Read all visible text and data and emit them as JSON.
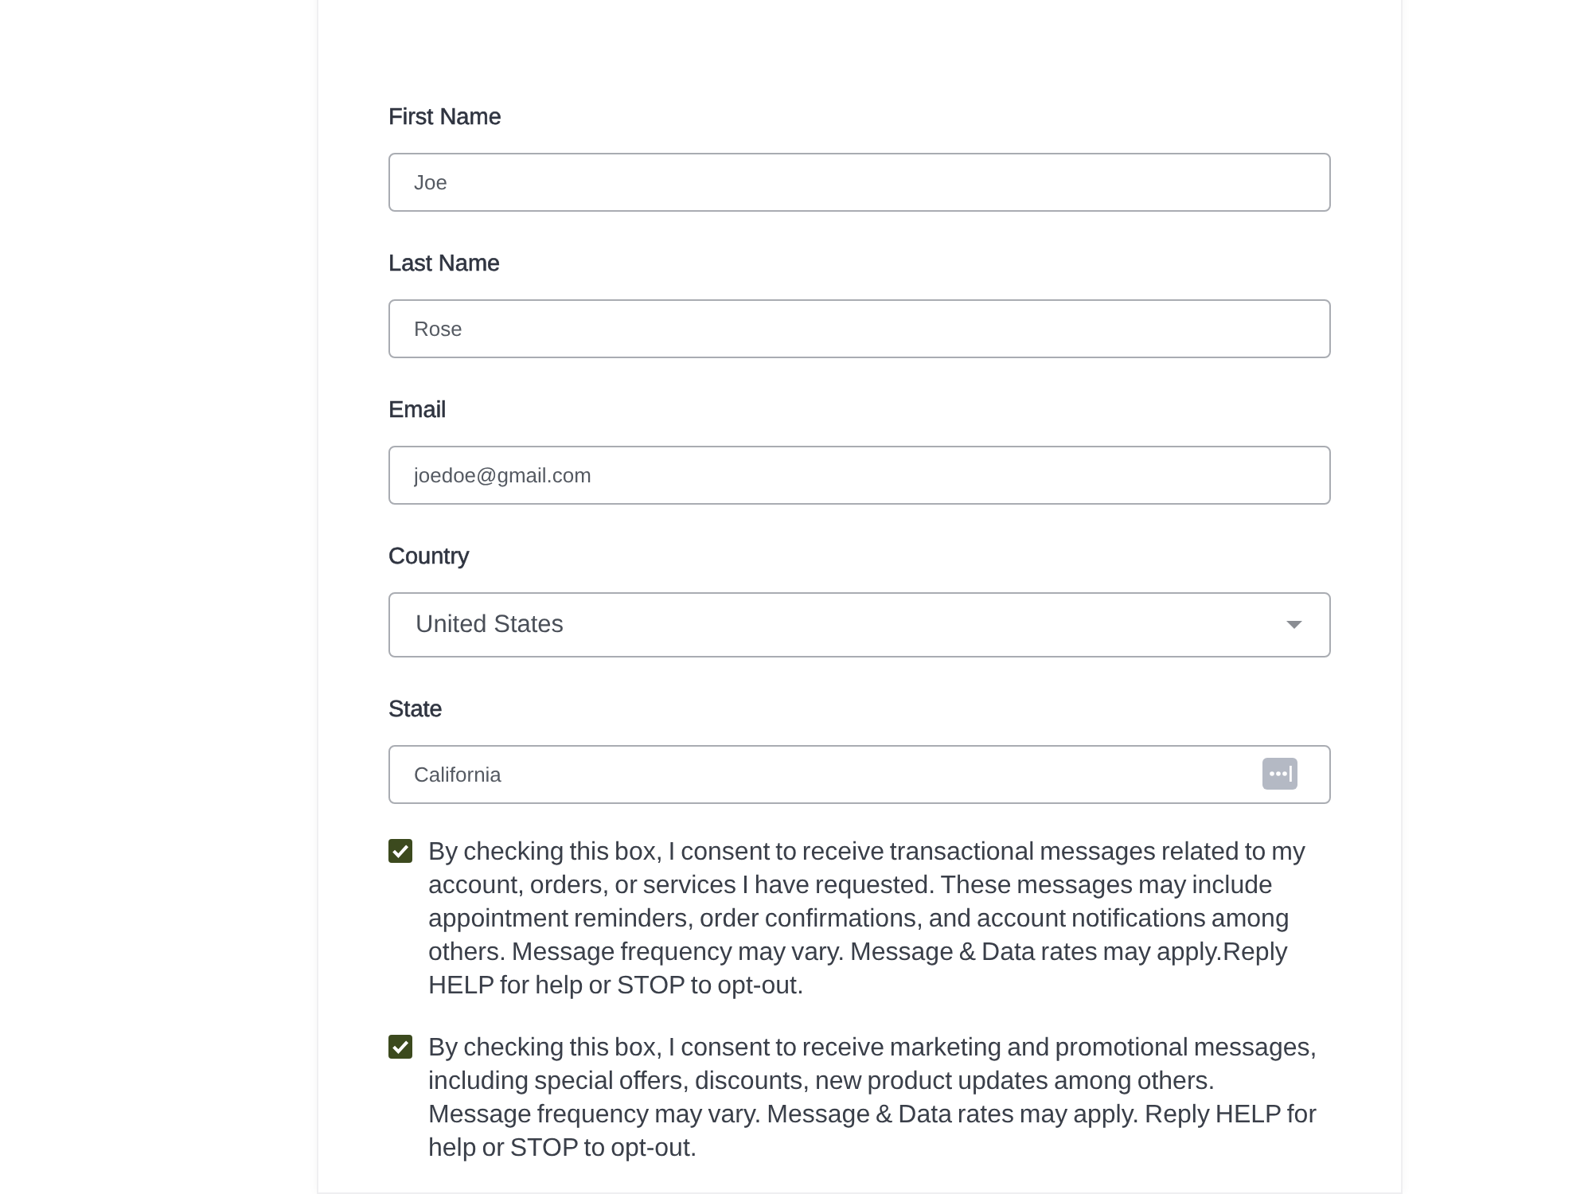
{
  "fields": [
    {
      "kind": "text",
      "label": "First Name",
      "value": "Joe"
    },
    {
      "kind": "text",
      "label": "Last Name",
      "value": "Rose"
    },
    {
      "kind": "text",
      "label": "Email",
      "value": "joedoe@gmail.com"
    },
    {
      "kind": "select",
      "label": "Country",
      "value": "United States"
    },
    {
      "kind": "autofill",
      "label": "State",
      "value": "California"
    }
  ],
  "consents": [
    {
      "checked": true,
      "text": "By checking this box, I consent to receive transactional messages related to my account, orders, or services I have requested. These messages may include appointment reminders, order confirmations, and account notifications among others. Message frequency may vary. Message & Data rates may apply.Reply HELP for help or STOP to opt-out."
    },
    {
      "checked": true,
      "text": "By checking this box, I consent to receive marketing and promotional messages, including special offers, discounts, new product updates among others. Message frequency may vary. Message & Data rates may apply. Reply HELP for help or STOP to opt-out."
    }
  ]
}
